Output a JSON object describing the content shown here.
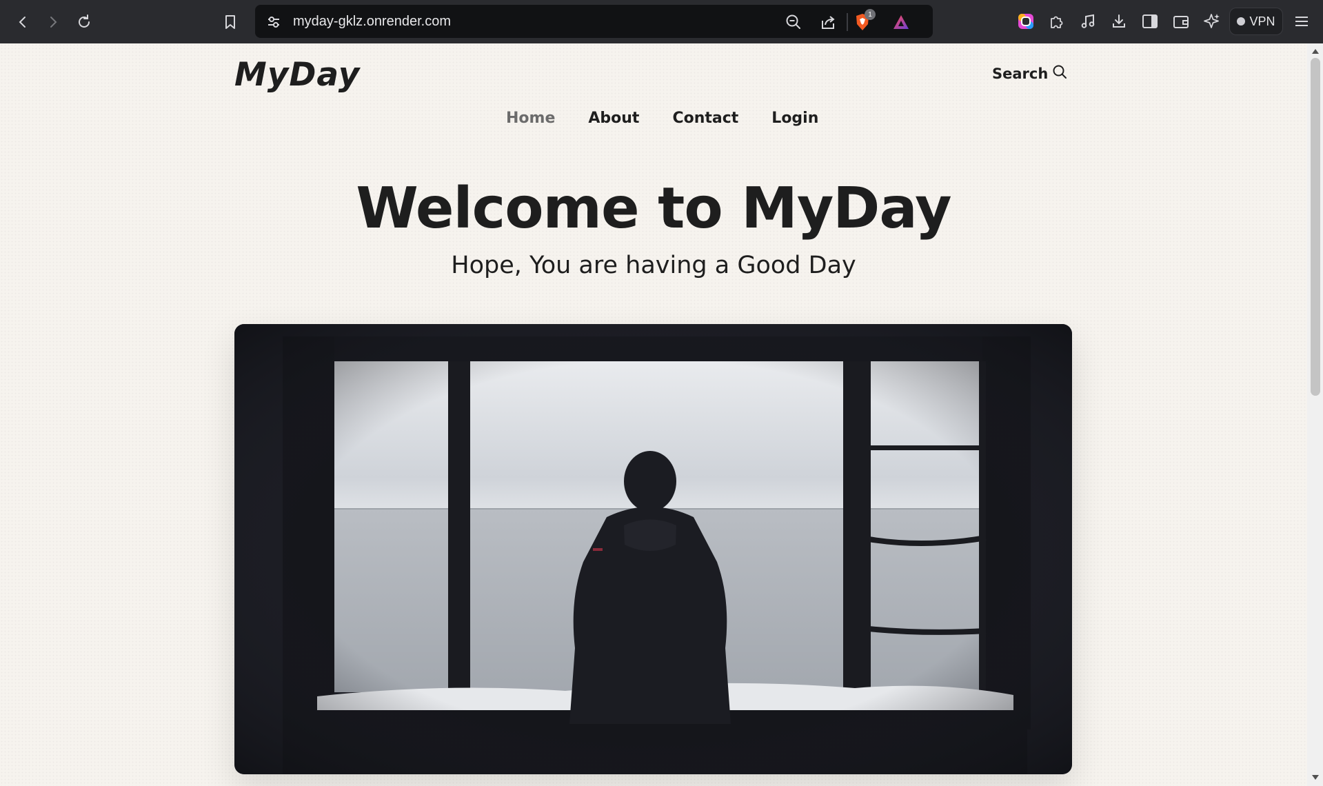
{
  "browser": {
    "url": "myday-gklz.onrender.com",
    "vpn_label": "VPN",
    "shield_badge": "1",
    "icons": [
      "back-icon",
      "forward-icon",
      "reload-icon",
      "bookmark-icon",
      "site-settings-icon",
      "zoom-out-icon",
      "share-icon",
      "brave-shield-icon",
      "rewards-icon",
      "color-extension-icon",
      "extensions-icon",
      "media-icon",
      "downloads-icon",
      "sidebar-icon",
      "wallet-icon",
      "leo-ai-icon",
      "menu-icon"
    ]
  },
  "site": {
    "logo": "MyDay",
    "search_label": "Search",
    "nav": [
      {
        "label": "Home",
        "active": true
      },
      {
        "label": "About",
        "active": false
      },
      {
        "label": "Contact",
        "active": false
      },
      {
        "label": "Login",
        "active": false
      }
    ],
    "hero": {
      "title": "Welcome to MyDay",
      "subtitle": "Hope, You are having a Good Day"
    }
  },
  "colors": {
    "page_bg": "#f6f3ee",
    "text": "#1e1e1e",
    "nav_active": "#6b6b6b",
    "chrome_bg": "#2a2b2f",
    "image_frame": "#1c1d24"
  }
}
